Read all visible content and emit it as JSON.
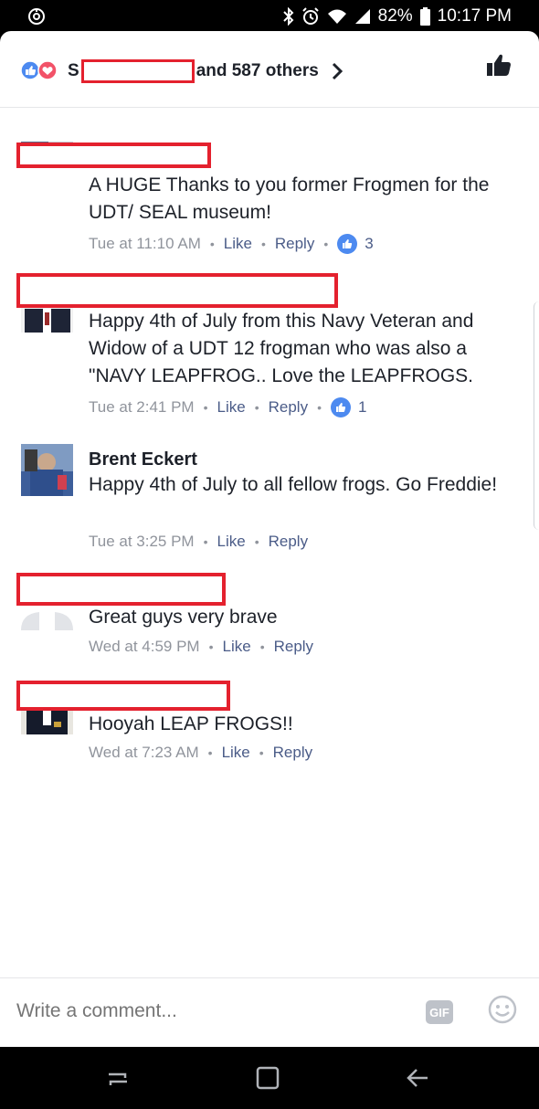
{
  "status_bar": {
    "battery_percent": "82%",
    "time": "10:17 PM",
    "icons": [
      "app-notification-icon",
      "bluetooth-icon",
      "alarm-icon",
      "wifi-icon",
      "signal-icon",
      "battery-icon"
    ]
  },
  "header": {
    "likers_prefix": "S",
    "likers_suffix": "and 587 others",
    "reaction_icons": [
      "like-reaction-icon",
      "love-reaction-icon"
    ]
  },
  "comments": [
    {
      "name_redacted": true,
      "text": "A HUGE Thanks to you former Frogmen for the UDT/ SEAL museum!",
      "time": "Tue at 11:10 AM",
      "like_label": "Like",
      "reply_label": "Reply",
      "likes": "3"
    },
    {
      "name_redacted": true,
      "text": "Happy 4th of July from this Navy Veteran and Widow of a UDT 12 frogman  who was also a \"NAVY LEAPFROG.. Love the LEAPFROGS.",
      "time": "Tue at 2:41 PM",
      "like_label": "Like",
      "reply_label": "Reply",
      "likes": "1"
    },
    {
      "name": "Brent Eckert",
      "text": "Happy 4th of July to all fellow frogs. Go Freddie!",
      "time": "Tue at 3:25 PM",
      "like_label": "Like",
      "reply_label": "Reply"
    },
    {
      "name_redacted": true,
      "text": "Great guys very brave",
      "time": "Wed at 4:59 PM",
      "like_label": "Like",
      "reply_label": "Reply"
    },
    {
      "name_redacted": true,
      "text": "Hooyah LEAP FROGS!!",
      "time": "Wed at 7:23 AM",
      "like_label": "Like",
      "reply_label": "Reply"
    }
  ],
  "composer": {
    "placeholder": "Write a comment...",
    "gif_label": "GIF"
  },
  "colors": {
    "brand_blue": "#4d8af0",
    "link_gray_blue": "#4b5c88",
    "meta_gray": "#90949c",
    "redaction_red": "#e4212e"
  }
}
